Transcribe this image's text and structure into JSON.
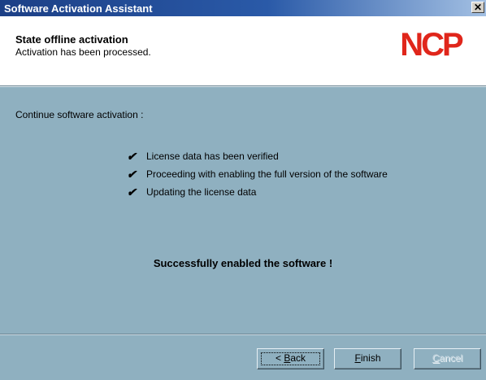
{
  "window": {
    "title": "Software Activation Assistant",
    "close_glyph": "✕"
  },
  "header": {
    "title": "State offline activation",
    "subtitle": "Activation has been processed.",
    "logo_text": "NCP",
    "logo_color": "#e0261b"
  },
  "content": {
    "intro": "Continue software activation :",
    "checklist": [
      {
        "icon": "checkmark-icon",
        "label": "License data has been verified"
      },
      {
        "icon": "checkmark-icon",
        "label": "Proceeding with enabling the full version of the software"
      },
      {
        "icon": "checkmark-icon",
        "label": "Updating the license data"
      }
    ],
    "success_message": "Successfully enabled the software !"
  },
  "buttons": {
    "back": {
      "prefix": "< ",
      "mnemonic": "B",
      "rest": "ack",
      "enabled": true,
      "focused": true
    },
    "finish": {
      "mnemonic": "F",
      "rest": "inish",
      "enabled": true
    },
    "cancel": {
      "mnemonic": "C",
      "rest": "ancel",
      "enabled": false
    }
  },
  "colors": {
    "titlebar_start": "#1c3f86",
    "titlebar_end": "#a3c0e3",
    "dialog_background": "#8fb0c0",
    "header_background": "#ffffff"
  }
}
